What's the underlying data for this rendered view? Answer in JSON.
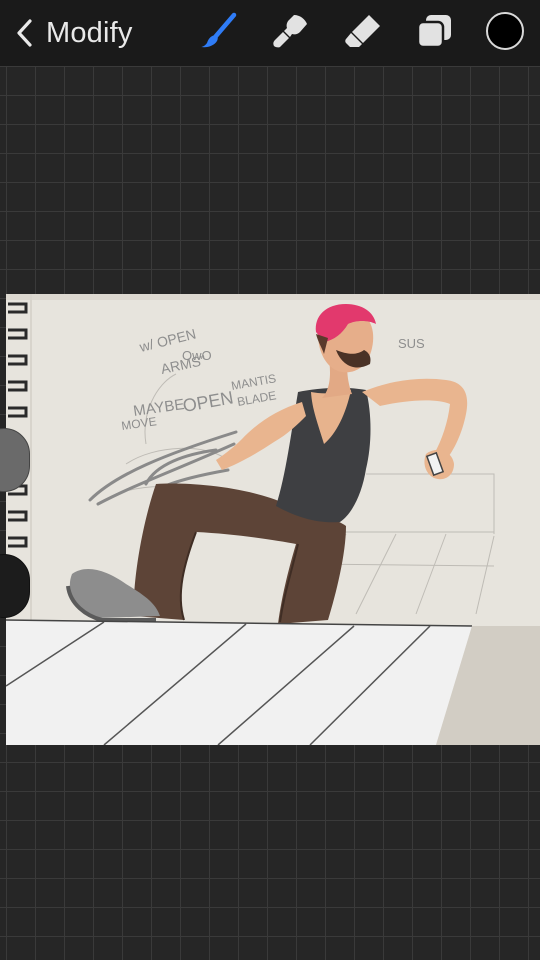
{
  "toolbar": {
    "back_label": "Modify",
    "tools": [
      {
        "name": "brush-icon",
        "active": true
      },
      {
        "name": "smudge-icon",
        "active": false
      },
      {
        "name": "eraser-icon",
        "active": false
      },
      {
        "name": "layers-icon",
        "active": false
      }
    ],
    "color_swatch": "#000000",
    "accent_color": "#2f7cf6"
  },
  "artwork": {
    "handwritten_notes": [
      "w/ OPEN ARMS\" OwO",
      "SUS",
      "MAYBE MOVE",
      "OPEN",
      "MANTIS BLADE"
    ]
  }
}
